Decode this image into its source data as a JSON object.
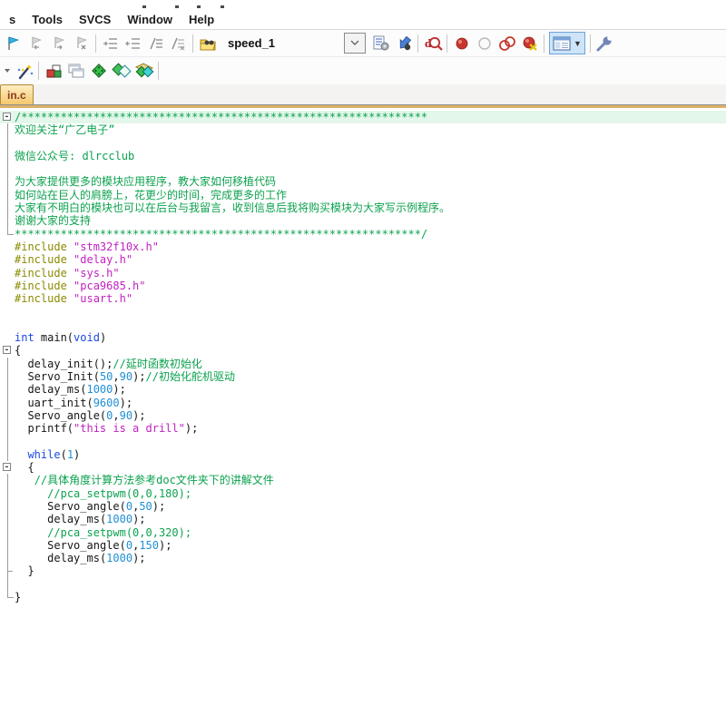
{
  "menu": {
    "items": [
      {
        "label": "s"
      },
      {
        "label": "Tools"
      },
      {
        "label": "SVCS"
      },
      {
        "label": "Window"
      },
      {
        "label": "Help"
      }
    ]
  },
  "toolbar": {
    "target": {
      "value": "speed_1"
    },
    "row1_icons": [
      "bookmark-toggle-icon",
      "bookmark-prev-icon",
      "bookmark-next-icon",
      "bookmark-clear-icon",
      "indent-icon",
      "unindent-icon",
      "comment-selection-icon",
      "uncomment-selection-icon",
      "load-target-icon",
      "target-select-dropdown",
      "options-for-target-icon",
      "download-debug-icon",
      "start-debug-session-icon",
      "breakpoint-toggle-icon",
      "breakpoint-disable-icon",
      "breakpoint-disable-all-icon",
      "breakpoint-kill-all-icon",
      "window-layout-icon",
      "configuration-wrench-icon"
    ],
    "row2_icons": [
      "toolbar-overflow-caret-icon",
      "wizard-wand-icon",
      "blocks-icon",
      "cascade-windows-icon",
      "memory-window-icon",
      "serial-window-icon",
      "analysis-window-icon"
    ]
  },
  "tabbar": {
    "tabs": [
      {
        "label": "in.c",
        "active": true
      }
    ]
  },
  "editor": {
    "colors": {
      "comment": "#0ca24f",
      "keyword": "#1a49e0",
      "number": "#1f8fd6",
      "string": "#c121c1",
      "preprocessor": "#8a8a00",
      "plain": "#161616",
      "highlight_line": "#e3f7ea"
    },
    "lines": [
      {
        "g": "box",
        "hl": true,
        "i": 0,
        "t": [
          [
            "cm",
            "/**************************************************************"
          ]
        ]
      },
      {
        "g": "line",
        "i": 0,
        "t": [
          [
            "cm",
            "欢迎关注“广乙电子”"
          ]
        ]
      },
      {
        "g": "line",
        "i": 0,
        "t": []
      },
      {
        "g": "line",
        "i": 0,
        "t": [
          [
            "cm",
            "微信公众号: dlrcclub"
          ]
        ]
      },
      {
        "g": "line",
        "i": 0,
        "t": []
      },
      {
        "g": "line",
        "i": 0,
        "t": [
          [
            "cm",
            "为大家提供更多的模块应用程序，教大家如何移植代码"
          ]
        ]
      },
      {
        "g": "line",
        "i": 0,
        "t": [
          [
            "cm",
            "如何站在巨人的肩膀上，花更少的时间，完成更多的工作"
          ]
        ]
      },
      {
        "g": "line",
        "i": 0,
        "t": [
          [
            "cm",
            "大家有不明白的模块也可以在后台与我留言，收到信息后我将购买模块为大家写示例程序。"
          ]
        ]
      },
      {
        "g": "line",
        "i": 0,
        "t": [
          [
            "cm",
            "谢谢大家的支持"
          ]
        ]
      },
      {
        "g": "end",
        "i": 0,
        "t": [
          [
            "cm",
            "**************************************************************/"
          ]
        ]
      },
      {
        "g": "none",
        "i": 0,
        "t": [
          [
            "pp",
            "#include"
          ],
          [
            "pl",
            " "
          ],
          [
            "str",
            "\"stm32f10x.h\""
          ]
        ]
      },
      {
        "g": "none",
        "i": 0,
        "t": [
          [
            "pp",
            "#include"
          ],
          [
            "pl",
            " "
          ],
          [
            "str",
            "\"delay.h\""
          ]
        ]
      },
      {
        "g": "none",
        "i": 0,
        "t": [
          [
            "pp",
            "#include"
          ],
          [
            "pl",
            " "
          ],
          [
            "str",
            "\"sys.h\""
          ]
        ]
      },
      {
        "g": "none",
        "i": 0,
        "t": [
          [
            "pp",
            "#include"
          ],
          [
            "pl",
            " "
          ],
          [
            "str",
            "\"pca9685.h\""
          ]
        ]
      },
      {
        "g": "none",
        "i": 0,
        "t": [
          [
            "pp",
            "#include"
          ],
          [
            "pl",
            " "
          ],
          [
            "str",
            "\"usart.h\""
          ]
        ]
      },
      {
        "g": "none",
        "i": 0,
        "t": []
      },
      {
        "g": "none",
        "i": 0,
        "t": []
      },
      {
        "g": "none",
        "i": 0,
        "t": [
          [
            "kw",
            "int"
          ],
          [
            "pl",
            " main("
          ],
          [
            "kw",
            "void"
          ],
          [
            "pl",
            ")"
          ]
        ]
      },
      {
        "g": "box",
        "i": 0,
        "t": [
          [
            "pl",
            "{"
          ]
        ]
      },
      {
        "g": "line",
        "i": 2,
        "t": [
          [
            "pl",
            "delay_init();"
          ],
          [
            "cm",
            "//延时函数初始化"
          ]
        ]
      },
      {
        "g": "line",
        "i": 2,
        "t": [
          [
            "pl",
            "Servo_Init("
          ],
          [
            "num",
            "50"
          ],
          [
            "pl",
            ","
          ],
          [
            "num",
            "90"
          ],
          [
            "pl",
            ");"
          ],
          [
            "cm",
            "//初始化舵机驱动"
          ]
        ]
      },
      {
        "g": "line",
        "i": 2,
        "t": [
          [
            "pl",
            "delay_ms("
          ],
          [
            "num",
            "1000"
          ],
          [
            "pl",
            ");"
          ]
        ]
      },
      {
        "g": "line",
        "i": 2,
        "t": [
          [
            "pl",
            "uart_init("
          ],
          [
            "num",
            "9600"
          ],
          [
            "pl",
            ");"
          ]
        ]
      },
      {
        "g": "line",
        "i": 2,
        "t": [
          [
            "pl",
            "Servo_angle("
          ],
          [
            "num",
            "0"
          ],
          [
            "pl",
            ","
          ],
          [
            "num",
            "90"
          ],
          [
            "pl",
            ");"
          ]
        ]
      },
      {
        "g": "line",
        "i": 2,
        "t": [
          [
            "pl",
            "printf("
          ],
          [
            "str",
            "\"this is a drill\""
          ],
          [
            "pl",
            ");"
          ]
        ]
      },
      {
        "g": "line",
        "i": 0,
        "t": []
      },
      {
        "g": "line",
        "i": 2,
        "t": [
          [
            "kw",
            "while"
          ],
          [
            "pl",
            "("
          ],
          [
            "num",
            "1"
          ],
          [
            "pl",
            ")"
          ]
        ]
      },
      {
        "g": "box",
        "i": 2,
        "t": [
          [
            "pl",
            "{"
          ]
        ]
      },
      {
        "g": "line",
        "i": 3,
        "t": [
          [
            "cm",
            "//具体角度计算方法参考doc文件夹下的讲解文件"
          ]
        ]
      },
      {
        "g": "line",
        "i": 5,
        "t": [
          [
            "cm",
            "//pca_setpwm(0,0,180);"
          ]
        ]
      },
      {
        "g": "line",
        "i": 5,
        "t": [
          [
            "pl",
            "Servo_angle("
          ],
          [
            "num",
            "0"
          ],
          [
            "pl",
            ","
          ],
          [
            "num",
            "50"
          ],
          [
            "pl",
            ");"
          ]
        ]
      },
      {
        "g": "line",
        "i": 5,
        "t": [
          [
            "pl",
            "delay_ms("
          ],
          [
            "num",
            "1000"
          ],
          [
            "pl",
            ");"
          ]
        ]
      },
      {
        "g": "line",
        "i": 5,
        "t": [
          [
            "cm",
            "//pca_setpwm(0,0,320);"
          ]
        ]
      },
      {
        "g": "line",
        "i": 5,
        "t": [
          [
            "pl",
            "Servo_angle("
          ],
          [
            "num",
            "0"
          ],
          [
            "pl",
            ","
          ],
          [
            "num",
            "150"
          ],
          [
            "pl",
            ");"
          ]
        ]
      },
      {
        "g": "line",
        "i": 5,
        "t": [
          [
            "pl",
            "delay_ms("
          ],
          [
            "num",
            "1000"
          ],
          [
            "pl",
            ");"
          ]
        ]
      },
      {
        "g": "endline",
        "i": 2,
        "t": [
          [
            "pl",
            "}"
          ]
        ]
      },
      {
        "g": "line",
        "i": 0,
        "t": []
      },
      {
        "g": "end",
        "i": 0,
        "t": [
          [
            "pl",
            "}"
          ]
        ]
      }
    ]
  }
}
